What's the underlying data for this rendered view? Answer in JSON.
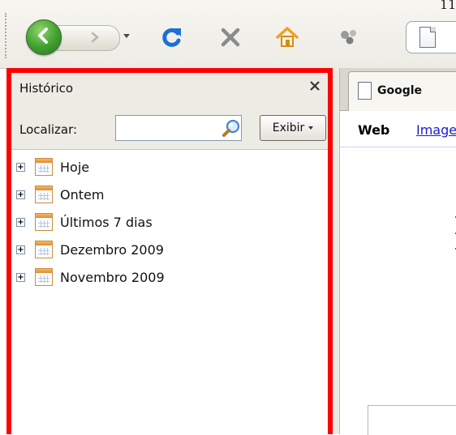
{
  "toolbar": {
    "icons": [
      "back-arrow-icon",
      "forward-arrow-icon",
      "reload-icon",
      "stop-icon",
      "home-icon",
      "bookmarks-icon",
      "page-icon"
    ],
    "colors": {
      "back": "#3f9e2e",
      "reload": "#1d6fd6",
      "stop": "#8b8b8b",
      "home": "#f0a020"
    },
    "corner_text": "11"
  },
  "sidebar": {
    "title": "Histórico",
    "close_icon": "close-icon",
    "search_label": "Localizar:",
    "search_value": "",
    "view_button": "Exibir",
    "items": [
      {
        "label": "Hoje",
        "expander": "+"
      },
      {
        "label": "Ontem",
        "expander": "+"
      },
      {
        "label": "Últimos 7 dias",
        "expander": "+"
      },
      {
        "label": "Dezembro 2009",
        "expander": "+"
      },
      {
        "label": "Novembro 2009",
        "expander": "+"
      }
    ],
    "highlight_color": "#ff0000"
  },
  "browser": {
    "tab_title": "Google",
    "nav_web": "Web",
    "nav_images": "Imagens"
  }
}
